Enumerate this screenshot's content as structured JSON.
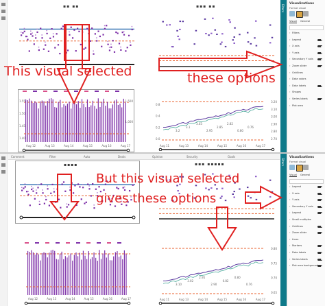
{
  "annotations": {
    "top_selected": "This visual selected",
    "top_options": "these options",
    "bottom_selected": "But this visual selected",
    "bottom_options": "gives these options"
  },
  "filters_tab": "Filters",
  "toolstrip_labels": [
    "Comment",
    "Filter",
    "Auto",
    "Deals",
    "Opinion",
    "Security",
    "Goals"
  ],
  "panel1": {
    "viz": {
      "title": "Visualizations",
      "subtitle": "Format visual",
      "tabs": [
        "Visual",
        "General"
      ],
      "search_placeholder": "Search",
      "options": [
        {
          "label": "Filters",
          "toggle": false
        },
        {
          "label": "Legend",
          "toggle": true
        },
        {
          "label": "X axis",
          "toggle": true
        },
        {
          "label": "Y axis",
          "toggle": true
        },
        {
          "label": "Secondary Y axis",
          "toggle": true
        },
        {
          "label": "Zoom slider",
          "toggle": true
        },
        {
          "label": "Gridlines",
          "toggle": false
        },
        {
          "label": "Data colors",
          "toggle": false
        },
        {
          "label": "Data labels",
          "toggle": true
        },
        {
          "label": "Shapes",
          "toggle": false
        },
        {
          "label": "Series labels",
          "toggle": true
        },
        {
          "label": "Plot area",
          "toggle": false
        }
      ]
    },
    "right_chart": {
      "values_right": [
        "3.20",
        "3.10",
        "3.00",
        "2.90",
        "2.80",
        "2.70"
      ],
      "data_labels": [
        "3.2",
        "3.1",
        "3.03",
        "2.95",
        "2.85",
        "2.82",
        "0.80",
        "0.76"
      ],
      "y_left": [
        "0.8",
        "0.4",
        "0.2",
        "0.0"
      ],
      "xticks": [
        "Aug 11",
        "Aug 13",
        "Aug 14",
        "Aug 15",
        "Aug 16",
        "Aug 17"
      ]
    },
    "left_chart": {
      "xticks": [
        "Aug 12",
        "Aug 13",
        "Aug 14",
        "Aug 15",
        "Aug 16",
        "Aug 17"
      ],
      "y_left": [
        "1.55",
        "1.50",
        "1.45",
        "1.40"
      ],
      "y_right": [
        "1,500",
        "1,000"
      ]
    }
  },
  "panel2": {
    "viz": {
      "title": "Visualizations",
      "subtitle": "Format visual",
      "tabs": [
        "Visual",
        "General"
      ],
      "search_placeholder": "Search",
      "options": [
        {
          "label": "Legend",
          "toggle": true
        },
        {
          "label": "X axis",
          "toggle": true
        },
        {
          "label": "Y axis",
          "toggle": true
        },
        {
          "label": "Secondary Y axis",
          "toggle": true
        },
        {
          "label": "Legend",
          "toggle": true
        },
        {
          "label": "Small multiples",
          "toggle": false
        },
        {
          "label": "Gridlines",
          "toggle": true
        },
        {
          "label": "Zoom slider",
          "toggle": true
        },
        {
          "label": "Lines",
          "toggle": false
        },
        {
          "label": "Markers",
          "toggle": true
        },
        {
          "label": "Data labels",
          "toggle": true
        },
        {
          "label": "Series labels",
          "toggle": true
        },
        {
          "label": "Plot area background",
          "toggle": true
        }
      ]
    },
    "right_chart": {
      "values_right": [
        "0.80",
        "0.75",
        "0.70",
        "0.65"
      ],
      "data_labels": [
        "3.10",
        "3.02",
        "2.95",
        "2.90",
        "0.82",
        "0.80",
        "0.76"
      ],
      "xticks": [
        "Aug 11",
        "Aug 13",
        "Aug 14",
        "Aug 15",
        "Aug 16",
        "Aug 17"
      ]
    },
    "left_chart": {
      "xticks": [
        "Aug 12",
        "Aug 13",
        "Aug 14",
        "Aug 15",
        "Aug 16",
        "Aug 17"
      ]
    }
  },
  "colors": {
    "annotation_red": "#e02020",
    "purple_series": "#7d2fa8",
    "blue_series": "#2b6cb0",
    "orange_dashed": "#e8612c",
    "teal_filters": "#0e7a8a"
  }
}
